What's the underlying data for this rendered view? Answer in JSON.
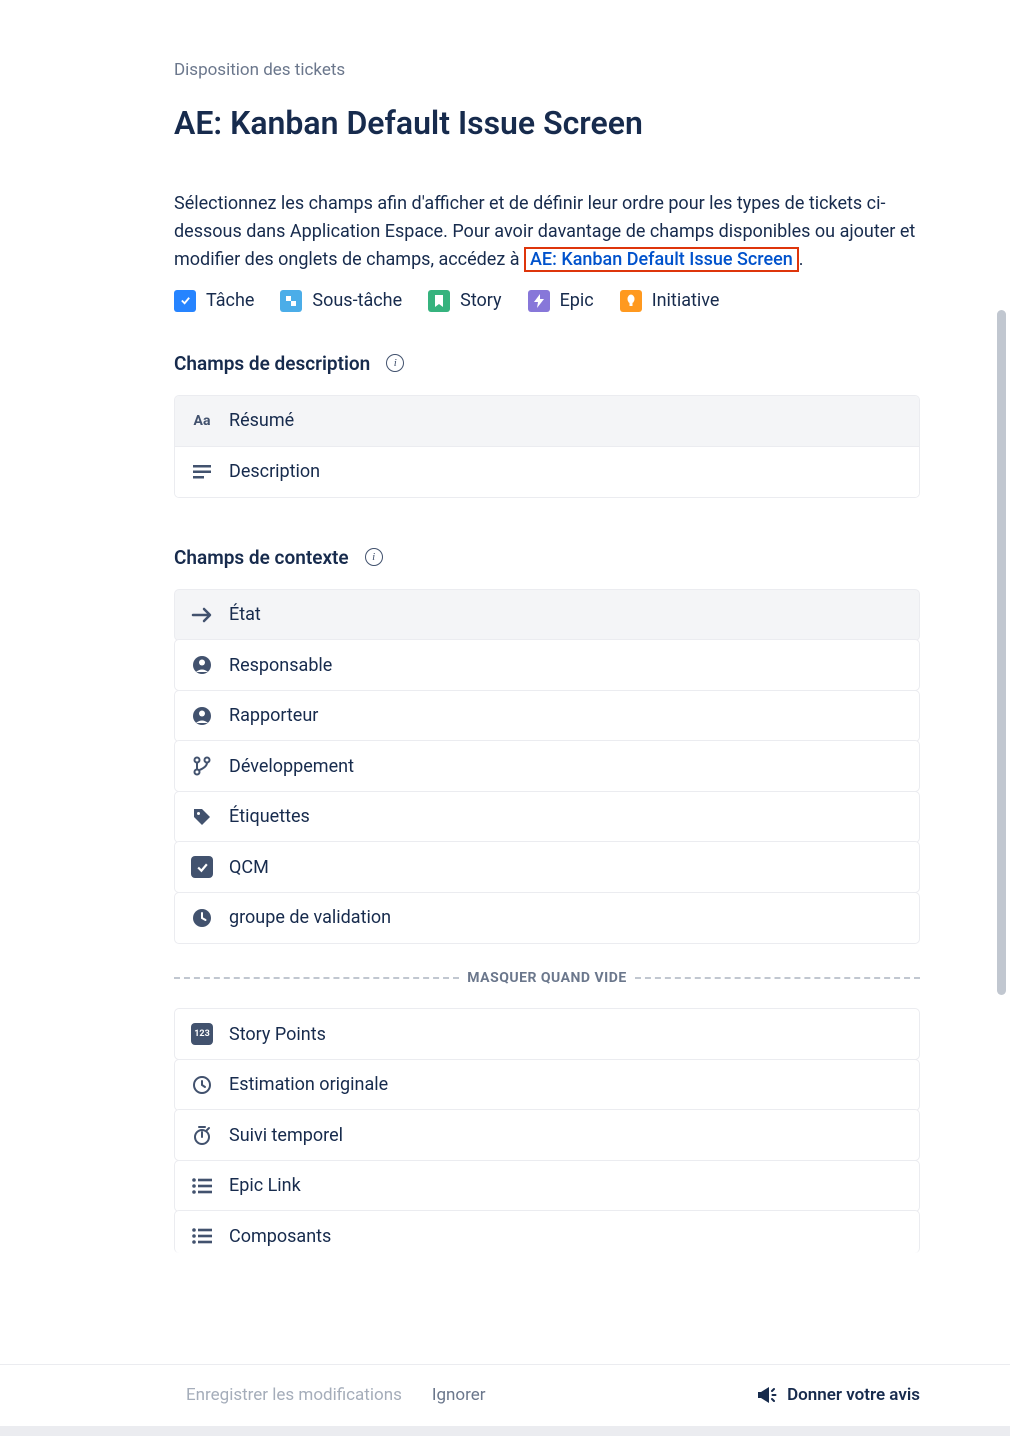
{
  "breadcrumb": "Disposition des tickets",
  "page_title": "AE: Kanban Default Issue Screen",
  "intro": {
    "text_prefix": "Sélectionnez les champs afin d'afficher et de définir leur ordre pour les types de tickets ci-dessous dans Application Espace. Pour avoir davantage de champs disponibles ou ajouter et modifier des onglets de champs, accédez à ",
    "link_text": "AE: Kanban Default Issue Screen",
    "text_suffix": "."
  },
  "issue_types": {
    "task": "Tâche",
    "subtask": "Sous-tâche",
    "story": "Story",
    "epic": "Epic",
    "initiative": "Initiative"
  },
  "sections": {
    "description": "Champs de description",
    "context": "Champs de contexte"
  },
  "description_fields": {
    "summary": "Résumé",
    "description": "Description"
  },
  "context_fields": {
    "status": "État",
    "assignee": "Responsable",
    "reporter": "Rapporteur",
    "development": "Développement",
    "labels": "Étiquettes",
    "qcm": "QCM",
    "validation_group": "groupe de validation"
  },
  "hide_when_empty": "MASQUER QUAND VIDE",
  "hide_fields": {
    "story_points": "Story Points",
    "original_estimate": "Estimation originale",
    "time_tracking": "Suivi temporel",
    "epic_link": "Epic Link",
    "components": "Composants"
  },
  "footer": {
    "save": "Enregistrer les modifications",
    "ignore": "Ignorer",
    "feedback": "Donner votre avis"
  }
}
